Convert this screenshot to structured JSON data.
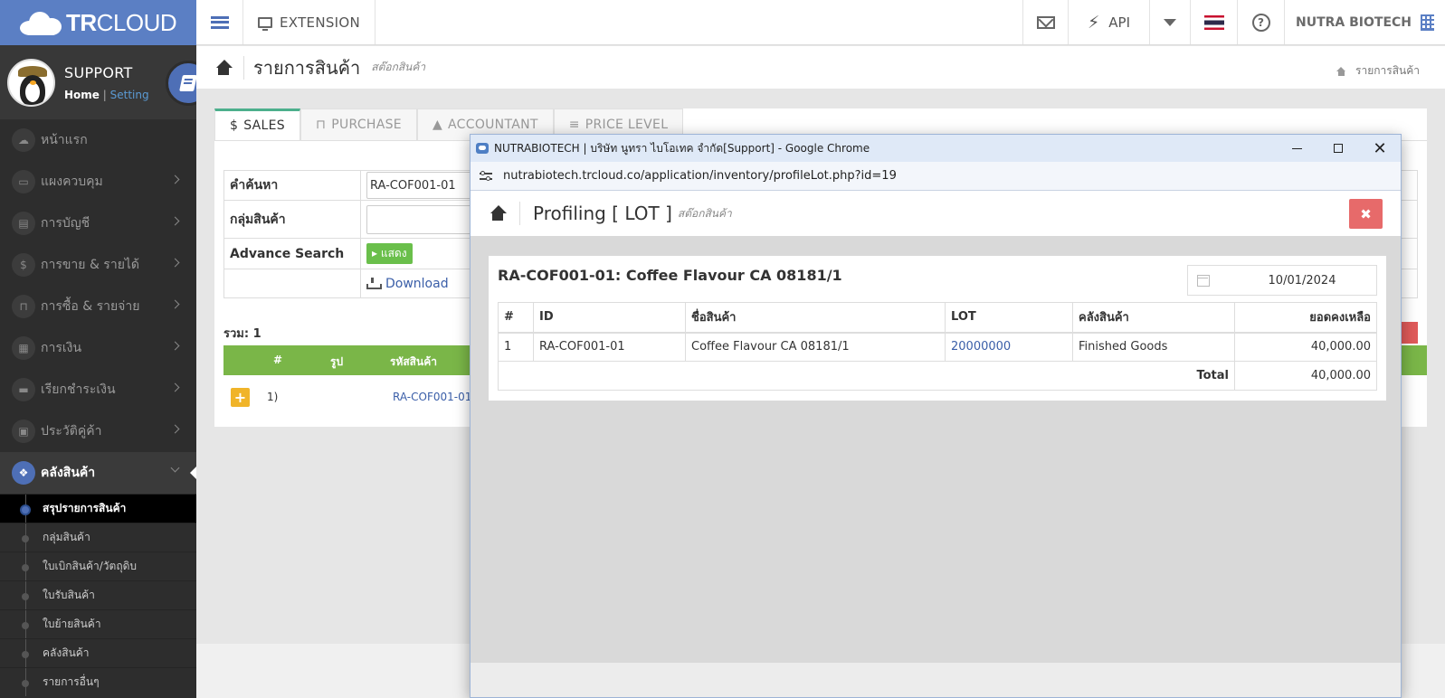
{
  "brand": {
    "logo_bold": "TR",
    "logo_light": "CLOUD"
  },
  "topbar": {
    "extension_label": "EXTENSION",
    "api_label": "API",
    "company_name": "NUTRA BIOTECH"
  },
  "profile": {
    "name": "SUPPORT",
    "home_link": "Home",
    "setting_link": "Setting"
  },
  "sidebar": {
    "items": [
      {
        "label": "หน้าแรก",
        "icon": "cloud-icon"
      },
      {
        "label": "แผงควบคุม",
        "icon": "monitor-icon"
      },
      {
        "label": "การบัญชี",
        "icon": "book-icon"
      },
      {
        "label": "การขาย & รายได้",
        "icon": "dollar-icon"
      },
      {
        "label": "การซื้อ & รายจ่าย",
        "icon": "cart-icon"
      },
      {
        "label": "การเงิน",
        "icon": "calendar-icon"
      },
      {
        "label": "เรียกชำระเงิน",
        "icon": "card-icon"
      },
      {
        "label": "ประวัติคู่ค้า",
        "icon": "contact-icon"
      },
      {
        "label": "คลังสินค้า",
        "icon": "boxes-icon"
      }
    ],
    "subitems": [
      "สรุปรายการสินค้า",
      "กลุ่มสินค้า",
      "ใบเบิกสินค้า/วัตถุดิบ",
      "ใบรับสินค้า",
      "ใบย้ายสินค้า",
      "คลังสินค้า",
      "รายการอื่นๆ"
    ]
  },
  "page": {
    "title": "รายการสินค้า",
    "subtitle": "สต๊อกสินค้า",
    "breadcrumb": "รายการสินค้า"
  },
  "tabs": [
    {
      "label": "SALES",
      "icon": "$"
    },
    {
      "label": "PURCHASE",
      "icon": "cart"
    },
    {
      "label": "ACCOUNTANT",
      "icon": "grad-cap"
    },
    {
      "label": "PRICE LEVEL",
      "icon": "list"
    }
  ],
  "search": {
    "search_label": "คำค้นหา",
    "search_value": "RA-COF001-01",
    "group_label": "กลุ่มสินค้า",
    "group_value": "",
    "advance_label": "Advance Search",
    "show_button": "แสดง",
    "download_label": "Download"
  },
  "list": {
    "total_text": "รวม: 1",
    "headers": [
      "#",
      "รูป",
      "รหัสสินค้า"
    ],
    "rows": [
      {
        "no": "1)",
        "code": "RA-COF001-01"
      }
    ]
  },
  "popup": {
    "window_title": "NUTRABIOTECH | บริษัท นูทรา ไบโอเทค จำกัด[Support] - Google Chrome",
    "url": "nutrabiotech.trcloud.co/application/inventory/profileLot.php?id=19",
    "heading": "Profiling [ LOT ]",
    "heading_sub": "สต๊อกสินค้า",
    "close_glyph": "✖",
    "product_title": "RA-COF001-01: Coffee Flavour CA 08181/1",
    "date": "10/01/2024",
    "table": {
      "headers": [
        "#",
        "ID",
        "ชื่อสินค้า",
        "LOT",
        "คลังสินค้า",
        "ยอดคงเหลือ"
      ],
      "rows": [
        {
          "no": "1",
          "id": "RA-COF001-01",
          "name": "Coffee Flavour CA 08181/1",
          "lot": "20000000",
          "warehouse": "Finished Goods",
          "balance": "40,000.00"
        }
      ],
      "total_label": "Total",
      "total_value": "40,000.00"
    }
  },
  "colors": {
    "brand": "#5b7fc4",
    "sidebar_bg": "#2d2d2d",
    "grid_header": "#7ab648",
    "close_btn": "#e76a6a",
    "active_tab": "#4caf8c"
  }
}
